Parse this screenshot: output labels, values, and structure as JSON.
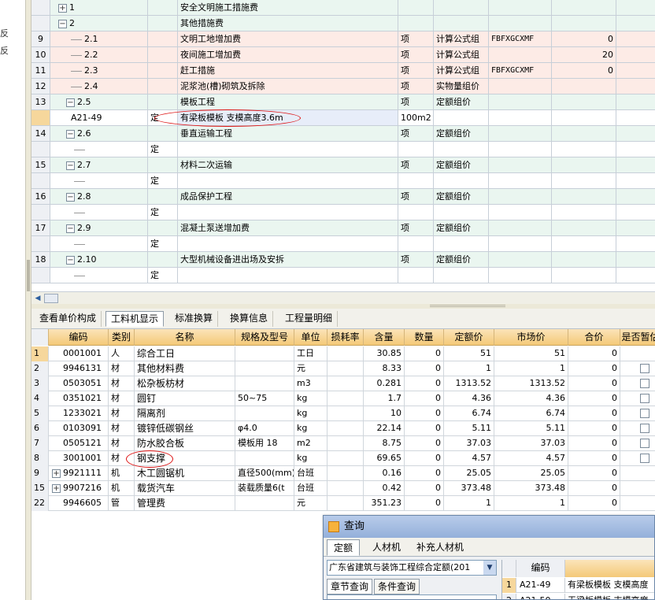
{
  "left_strip": {
    "glyph_1": "反",
    "glyph_2": "反"
  },
  "top_rows": [
    {
      "idx": "",
      "code": "1",
      "node": "plus",
      "type": "",
      "name": "安全文明施工措施费",
      "unit": "",
      "calc": "",
      "base": "",
      "rate": "",
      "style": "gr"
    },
    {
      "idx": "",
      "code": "2",
      "node": "minus",
      "type": "",
      "name": "其他措施费",
      "unit": "",
      "calc": "",
      "base": "",
      "rate": "",
      "style": "gr"
    },
    {
      "idx": "9",
      "code": "2.1",
      "node": "line",
      "type": "",
      "name": "文明工地增加费",
      "unit": "项",
      "calc": "计算公式组",
      "base": "FBFXGCXMF",
      "rate": "0",
      "style": "hl"
    },
    {
      "idx": "10",
      "code": "2.2",
      "node": "line",
      "type": "",
      "name": "夜间施工增加费",
      "unit": "项",
      "calc": "计算公式组",
      "base": "",
      "rate": "20",
      "style": "hl"
    },
    {
      "idx": "11",
      "code": "2.3",
      "node": "line",
      "type": "",
      "name": "赶工措施",
      "unit": "项",
      "calc": "计算公式组",
      "base": "FBFXGCXMF",
      "rate": "0",
      "style": "hl"
    },
    {
      "idx": "12",
      "code": "2.4",
      "node": "line",
      "type": "",
      "name": "泥浆池(槽)砌筑及拆除",
      "unit": "项",
      "calc": "实物量组价",
      "base": "",
      "rate": "",
      "style": "hl"
    },
    {
      "idx": "13",
      "code": "2.5",
      "node": "minus",
      "type": "",
      "name": "模板工程",
      "unit": "项",
      "calc": "定额组价",
      "base": "",
      "rate": "",
      "style": "gr"
    },
    {
      "idx": "",
      "code": "A21-49",
      "node": "sub",
      "type": "定",
      "name": "有梁板模板 支模高度3.6m",
      "unit": "100m2",
      "calc": "",
      "base": "",
      "rate": "",
      "style": "wh",
      "selected": true
    },
    {
      "idx": "14",
      "code": "2.6",
      "node": "minus",
      "type": "",
      "name": "垂直运输工程",
      "unit": "项",
      "calc": "定额组价",
      "base": "",
      "rate": "",
      "style": "gr"
    },
    {
      "idx": "",
      "code": "",
      "node": "sub",
      "type": "定",
      "name": "",
      "unit": "",
      "calc": "",
      "base": "",
      "rate": "",
      "style": "wh"
    },
    {
      "idx": "15",
      "code": "2.7",
      "node": "minus",
      "type": "",
      "name": "材料二次运输",
      "unit": "项",
      "calc": "定额组价",
      "base": "",
      "rate": "",
      "style": "gr"
    },
    {
      "idx": "",
      "code": "",
      "node": "sub",
      "type": "定",
      "name": "",
      "unit": "",
      "calc": "",
      "base": "",
      "rate": "",
      "style": "wh"
    },
    {
      "idx": "16",
      "code": "2.8",
      "node": "minus",
      "type": "",
      "name": "成品保护工程",
      "unit": "项",
      "calc": "定额组价",
      "base": "",
      "rate": "",
      "style": "gr"
    },
    {
      "idx": "",
      "code": "",
      "node": "sub",
      "type": "定",
      "name": "",
      "unit": "",
      "calc": "",
      "base": "",
      "rate": "",
      "style": "wh"
    },
    {
      "idx": "17",
      "code": "2.9",
      "node": "minus",
      "type": "",
      "name": "混凝土泵送增加费",
      "unit": "项",
      "calc": "定额组价",
      "base": "",
      "rate": "",
      "style": "gr"
    },
    {
      "idx": "",
      "code": "",
      "node": "sub",
      "type": "定",
      "name": "",
      "unit": "",
      "calc": "",
      "base": "",
      "rate": "",
      "style": "wh"
    },
    {
      "idx": "18",
      "code": "2.10",
      "node": "minus",
      "type": "",
      "name": "大型机械设备进出场及安拆",
      "unit": "项",
      "calc": "定额组价",
      "base": "",
      "rate": "",
      "style": "gr"
    },
    {
      "idx": "",
      "code": "",
      "node": "sub",
      "type": "定",
      "name": "",
      "unit": "",
      "calc": "",
      "base": "",
      "rate": "",
      "style": "wh"
    }
  ],
  "bottom_tabs": [
    "查看单价构成",
    "工料机显示",
    "标准换算",
    "换算信息",
    "工程量明细"
  ],
  "bottom_active_tab": 1,
  "bottom_headers": [
    "",
    "编码",
    "类别",
    "名称",
    "规格及型号",
    "单位",
    "损耗率",
    "含量",
    "数量",
    "定额价",
    "市场价",
    "合价",
    "是否暂估"
  ],
  "bottom_rows": [
    {
      "idx": "1",
      "expand": false,
      "code": "0001001",
      "cat": "人",
      "name": "综合工日",
      "spec": "",
      "unit": "工日",
      "loss": "",
      "qty": "30.85",
      "num": "0",
      "quota": "51",
      "market": "51",
      "sum": "0",
      "check": false
    },
    {
      "idx": "2",
      "expand": false,
      "code": "9946131",
      "cat": "材",
      "name": "其他材料费",
      "spec": "",
      "unit": "元",
      "loss": "",
      "qty": "8.33",
      "num": "0",
      "quota": "1",
      "market": "1",
      "sum": "0",
      "check": true
    },
    {
      "idx": "3",
      "expand": false,
      "code": "0503051",
      "cat": "材",
      "name": "松杂板枋材",
      "spec": "",
      "unit": "m3",
      "loss": "",
      "qty": "0.281",
      "num": "0",
      "quota": "1313.52",
      "market": "1313.52",
      "sum": "0",
      "check": true
    },
    {
      "idx": "4",
      "expand": false,
      "code": "0351021",
      "cat": "材",
      "name": "圆钉",
      "spec": "50~75",
      "unit": "kg",
      "loss": "",
      "qty": "1.7",
      "num": "0",
      "quota": "4.36",
      "market": "4.36",
      "sum": "0",
      "check": true
    },
    {
      "idx": "5",
      "expand": false,
      "code": "1233021",
      "cat": "材",
      "name": "隔离剂",
      "spec": "",
      "unit": "kg",
      "loss": "",
      "qty": "10",
      "num": "0",
      "quota": "6.74",
      "market": "6.74",
      "sum": "0",
      "check": true
    },
    {
      "idx": "6",
      "expand": false,
      "code": "0103091",
      "cat": "材",
      "name": "镀锌低碳钢丝",
      "spec": "φ4.0",
      "unit": "kg",
      "loss": "",
      "qty": "22.14",
      "num": "0",
      "quota": "5.11",
      "market": "5.11",
      "sum": "0",
      "check": true
    },
    {
      "idx": "7",
      "expand": false,
      "code": "0505121",
      "cat": "材",
      "name": "防水胶合板",
      "spec": "模板用 18",
      "unit": "m2",
      "loss": "",
      "qty": "8.75",
      "num": "0",
      "quota": "37.03",
      "market": "37.03",
      "sum": "0",
      "check": true
    },
    {
      "idx": "8",
      "expand": false,
      "code": "3001001",
      "cat": "材",
      "name": "钢支撑",
      "spec": "",
      "unit": "kg",
      "loss": "",
      "qty": "69.65",
      "num": "0",
      "quota": "4.57",
      "market": "4.57",
      "sum": "0",
      "check": true
    },
    {
      "idx": "9",
      "expand": true,
      "code": "9921111",
      "cat": "机",
      "name": "木工圆锯机",
      "spec": "直径500(mm)",
      "unit": "台班",
      "loss": "",
      "qty": "0.16",
      "num": "0",
      "quota": "25.05",
      "market": "25.05",
      "sum": "0",
      "check": false
    },
    {
      "idx": "15",
      "expand": true,
      "code": "9907216",
      "cat": "机",
      "name": "载货汽车",
      "spec": "装载质量6(t",
      "unit": "台班",
      "loss": "",
      "qty": "0.42",
      "num": "0",
      "quota": "373.48",
      "market": "373.48",
      "sum": "0",
      "check": false
    },
    {
      "idx": "22",
      "expand": false,
      "code": "9946605",
      "cat": "管",
      "name": "管理费",
      "spec": "",
      "unit": "元",
      "loss": "",
      "qty": "351.23",
      "num": "0",
      "quota": "1",
      "market": "1",
      "sum": "0",
      "check": false
    }
  ],
  "query": {
    "title": "查询",
    "tabs": [
      "定额",
      "人材机",
      "补充人材机"
    ],
    "select_value": "广东省建筑与装饰工程综合定额(201",
    "subtabs": [
      "章节查询",
      "条件查询"
    ],
    "results_header_code": "编码",
    "results": [
      {
        "idx": "1",
        "code": "A21-49",
        "name": "有梁板模板 支模高度"
      },
      {
        "idx": "2",
        "code": "A21-50",
        "name": "无梁板模板 支模高度"
      }
    ]
  },
  "colors": {
    "highlight_row": "#fdebe6",
    "group_row": "#eaf6f0",
    "header": "#f4c978",
    "annotation": "#dd1111"
  },
  "icons": {
    "expand": "plus-box-icon",
    "collapse": "minus-box-icon",
    "dropdown": "chevron-down-icon",
    "query": "query-window-icon"
  }
}
